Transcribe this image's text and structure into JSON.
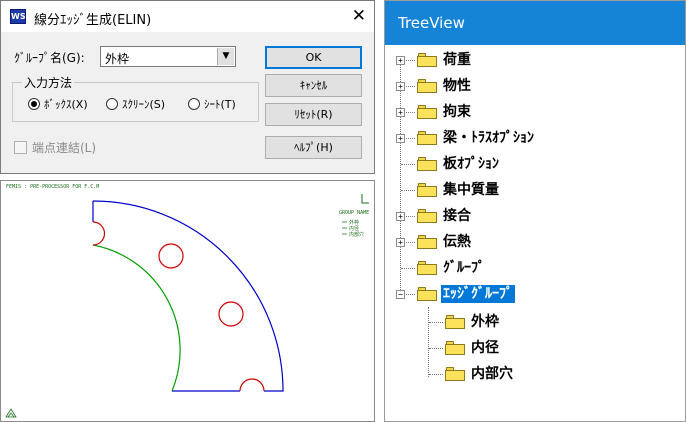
{
  "dialog": {
    "title": "線分ｴｯｼﾞ生成(ELIN)",
    "app_icon_text": "WS",
    "close_glyph": "✕",
    "group_label": "ｸﾞﾙｰﾌﾟ名(G):",
    "group_value": "外枠",
    "method_legend": "入力方法",
    "radios": [
      {
        "label": "ﾎﾞｯｸｽ(X)",
        "selected": true
      },
      {
        "label": "ｽｸﾘｰﾝ(S)",
        "selected": false
      },
      {
        "label": "ｼｰﾄ(T)",
        "selected": false
      }
    ],
    "endpoint_label": "端点連結(L)",
    "buttons": {
      "ok": "OK",
      "cancel": "ｷｬﾝｾﾙ",
      "reset": "ﾘｾｯﾄ(R)",
      "help": "ﾍﾙﾌﾟ(H)"
    }
  },
  "graphics": {
    "header": "FEMIS  :  PRE-PROCESSOR  FOR  F.C.M",
    "legend_title": "GROUP NAME",
    "legend_items": [
      "外枠",
      "内径",
      "内部穴"
    ],
    "colors": {
      "outer": "#0000c8",
      "inner": "#00a000",
      "holes": "#d00000"
    }
  },
  "treeview": {
    "title": "TreeView",
    "nodes": [
      {
        "label": "荷重",
        "expander": "+"
      },
      {
        "label": "物性",
        "expander": "+"
      },
      {
        "label": "拘束",
        "expander": "+"
      },
      {
        "label": "梁・ﾄﾗｽｵﾌﾟｼｮﾝ",
        "expander": "+"
      },
      {
        "label": "板ｵﾌﾟｼｮﾝ",
        "expander": ""
      },
      {
        "label": "集中質量",
        "expander": ""
      },
      {
        "label": "接合",
        "expander": "+"
      },
      {
        "label": "伝熱",
        "expander": "+"
      },
      {
        "label": "ｸﾞﾙｰﾌﾟ",
        "expander": ""
      },
      {
        "label": "ｴｯｼﾞｸﾞﾙｰﾌﾟ",
        "expander": "−",
        "selected": true
      }
    ],
    "children": [
      {
        "label": "外枠"
      },
      {
        "label": "内径"
      },
      {
        "label": "内部穴"
      }
    ]
  }
}
